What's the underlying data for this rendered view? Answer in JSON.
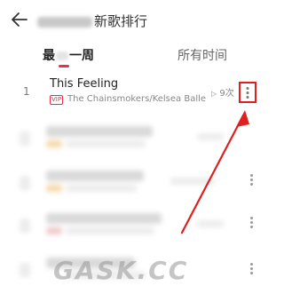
{
  "header": {
    "title": "新歌排行"
  },
  "tabs": [
    {
      "label_start": "最",
      "label_end": "一周",
      "selected": true
    },
    {
      "label": "所有时间",
      "selected": false
    }
  ],
  "colors": {
    "accent": "#e8304a",
    "highlight_box": "#e02020"
  },
  "songs": [
    {
      "rank": "1",
      "title": "This Feeling",
      "badge": "VIP",
      "artist": "The Chainsmokers/Kelsea Ballerin...",
      "play_count": "9次"
    }
  ],
  "icons": {
    "back": "arrow-left-icon",
    "play": "play-triangle-icon",
    "more": "more-vertical-icon"
  },
  "watermark": "GASK.CC"
}
